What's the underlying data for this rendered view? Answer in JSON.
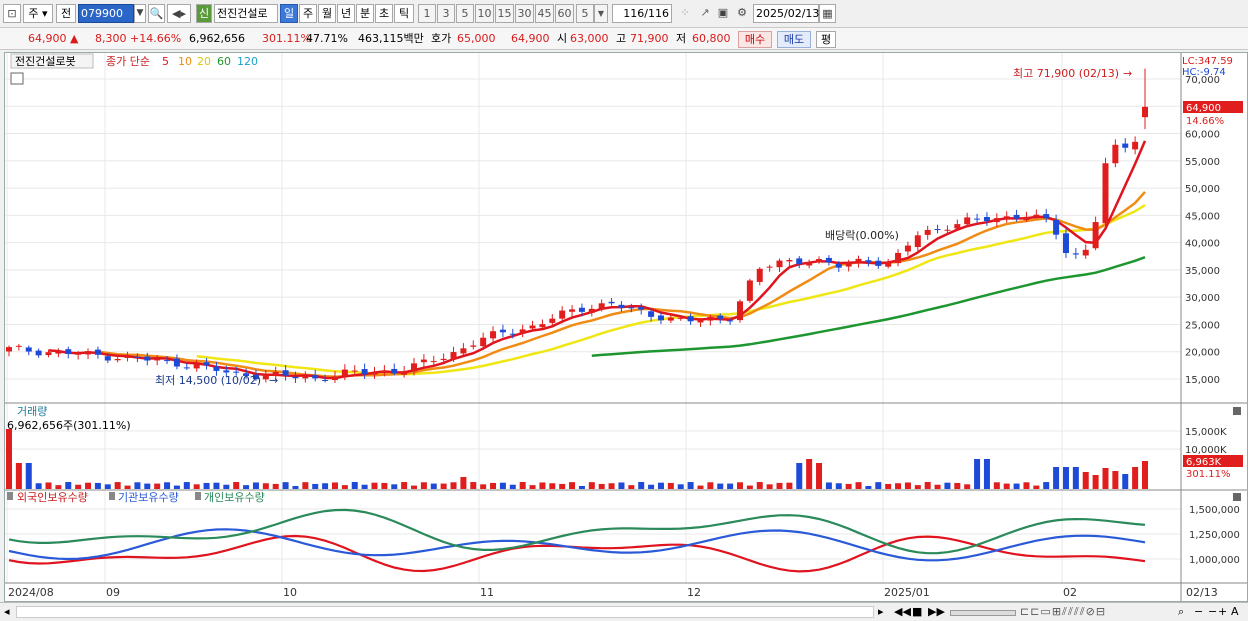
{
  "toolbar": {
    "period_type": "주",
    "market_prefix": "전",
    "stock_code": "079900",
    "new_badge": "신",
    "stock_name": "전진건설로",
    "periods": [
      "일",
      "주",
      "월",
      "년",
      "분",
      "초",
      "틱"
    ],
    "active_period": "일",
    "minute_options": [
      "1",
      "3",
      "5",
      "10",
      "15",
      "30",
      "45",
      "60"
    ],
    "custom_interval": "5",
    "count_display": "116",
    "count_total": "/116",
    "date": "2025/02/13"
  },
  "info": {
    "price": "64,900",
    "change": "8,300",
    "change_pct": "+14.66%",
    "volume": "6,962,656",
    "volume_ratio": "301.11%",
    "turnover": "47.71%",
    "amount": "463,115백만",
    "ask_label": "호가",
    "ask_value": "65,000",
    "bid_value": "64,900",
    "open_label": "시",
    "open_value": "63,000",
    "high_label": "고",
    "high_value": "71,900",
    "low_label": "저",
    "low_value": "60,800",
    "buy_button": "매수",
    "sell_button": "매도",
    "eval_button": "평"
  },
  "price_panel": {
    "legend_name": "전진건설로봇",
    "ma_label": "종가 단순",
    "ma_periods": [
      "5",
      "10",
      "20",
      "60",
      "120"
    ],
    "ma_colors": [
      "#e0141e",
      "#f08c14",
      "#f0e614",
      "#1e9630",
      "#1ea0c8"
    ],
    "lc_label": "LC:347.59",
    "hc_label": "HC:-9.74",
    "high_annotation": "최고 71,900 (02/13)",
    "low_annotation": "최저 14,500 (10/02)",
    "dividend_annotation": "배당락(0.00%)",
    "current_price_tag": "64,900",
    "current_pct_tag": "14.66%",
    "y_ticks": [
      "70,000",
      "65,000",
      "60,000",
      "55,000",
      "50,000",
      "45,000",
      "40,000",
      "35,000",
      "30,000",
      "25,000",
      "20,000",
      "15,000"
    ]
  },
  "volume_panel": {
    "title": "거래량",
    "value_label": "6,962,656주(301.11%)",
    "y_ticks": [
      "15,000K",
      "10,000K"
    ],
    "current_tag": "6,963K",
    "current_pct_tag": "301.11%"
  },
  "holding_panel": {
    "series_labels": [
      "외국인보유수량",
      "기관보유수량",
      "개인보유수량"
    ],
    "series_colors": [
      "#e0141e",
      "#2a5ad8",
      "#2a8a5a"
    ],
    "y_ticks": [
      "1,500,000",
      "1,250,000",
      "1,000,000"
    ]
  },
  "x_axis": {
    "labels": [
      "2024/08",
      "09",
      "10",
      "11",
      "12",
      "2025/01",
      "02"
    ],
    "last_date": "02/13"
  },
  "chart_data": {
    "type": "candlestick",
    "period": "daily",
    "last_close": 64900,
    "last_open": 63000,
    "last_high": 71900,
    "last_low": 60800,
    "period_high": 71900,
    "period_low": 14500,
    "ylim": [
      10000,
      72000
    ]
  }
}
